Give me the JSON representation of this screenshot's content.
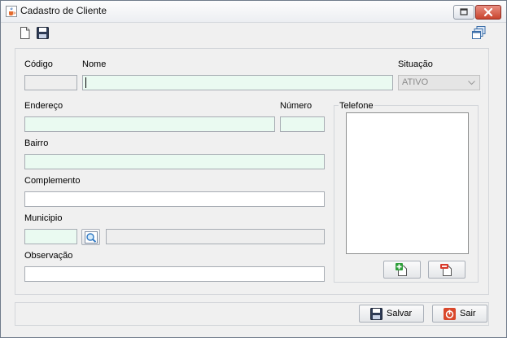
{
  "window": {
    "title": "Cadastro de Cliente"
  },
  "icons": {
    "app": "java-cup-icon",
    "new": "new-document-icon",
    "save": "floppy-disk-icon",
    "windows": "cascade-windows-icon",
    "search": "magnifier-icon",
    "add_phone": "add-icon",
    "remove_phone": "remove-icon",
    "exit": "power-icon"
  },
  "form": {
    "codigo": {
      "label": "Código",
      "value": ""
    },
    "nome": {
      "label": "Nome",
      "value": ""
    },
    "situacao": {
      "label": "Situação",
      "selected": "ATIVO"
    },
    "endereco": {
      "label": "Endereço",
      "value": ""
    },
    "numero": {
      "label": "Número",
      "value": ""
    },
    "bairro": {
      "label": "Bairro",
      "value": ""
    },
    "complemento": {
      "label": "Complemento",
      "value": ""
    },
    "municipio": {
      "label": "Municipio",
      "code": "",
      "name": ""
    },
    "observacao": {
      "label": "Observação",
      "value": ""
    }
  },
  "telefone": {
    "label": "Telefone",
    "items": []
  },
  "buttons": {
    "save": "Salvar",
    "exit": "Sair"
  },
  "colors": {
    "field_bg": "#eafaf1",
    "window_bg": "#f0f0f0",
    "close_button": "#c9452f"
  }
}
